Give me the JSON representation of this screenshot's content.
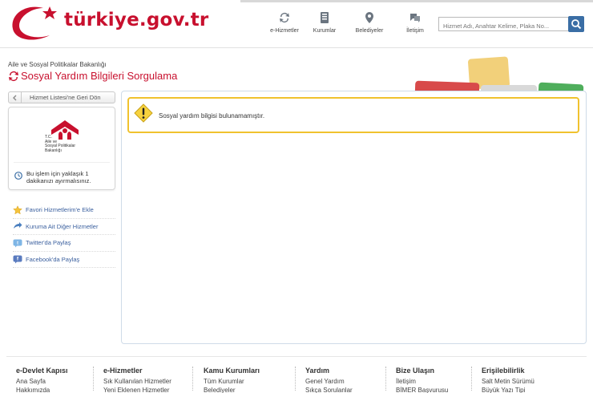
{
  "header": {
    "logo_text": "türkiye.gov.tr",
    "nav": [
      {
        "label": "e-Hizmetler",
        "icon": "refresh-arrows-icon"
      },
      {
        "label": "Kurumlar",
        "icon": "building-icon"
      },
      {
        "label": "Belediyeler",
        "icon": "map-pin-icon"
      },
      {
        "label": "İletişim",
        "icon": "chat-bubble-icon"
      }
    ],
    "search_placeholder": "Hizmet Adı, Anahtar Kelime, Plaka No...",
    "search_icon": "search-icon"
  },
  "page": {
    "breadcrumb": "Aile ve Sosyal Politikalar Bakanlığı",
    "title": "Sosyal Yardım Bilgileri Sorgulama"
  },
  "sidebar": {
    "back_label": "Hizmet Listesi'ne Geri Dön",
    "org_lines": [
      "T.C.",
      "Aile ve",
      "Sosyal Politikalar",
      "Bakanlığı"
    ],
    "time_text": "Bu işlem için yaklaşık 1 dakikanızı ayırmalısınız.",
    "links": [
      {
        "label": "Favori Hizmetlerim'e Ekle",
        "icon": "star-icon"
      },
      {
        "label": "Kuruma Ait Diğer Hizmetler",
        "icon": "arrow-icon"
      },
      {
        "label": "Twitter'da Paylaş",
        "icon": "twitter-icon"
      },
      {
        "label": "Facebook'da Paylaş",
        "icon": "facebook-icon"
      }
    ]
  },
  "main": {
    "alert_text": "Sosyal yardım bilgisi bulunamamıştır.",
    "alert_icon": "warning-icon"
  },
  "footer": {
    "columns": [
      {
        "heading": "e-Devlet Kapısı",
        "links": [
          "Ana Sayfa",
          "Hakkımızda"
        ]
      },
      {
        "heading": "e-Hizmetler",
        "links": [
          "Sık Kullanılan Hizmetler",
          "Yeni Eklenen Hizmetler"
        ]
      },
      {
        "heading": "Kamu Kurumları",
        "links": [
          "Tüm Kurumlar",
          "Belediyeler"
        ]
      },
      {
        "heading": "Yardım",
        "links": [
          "Genel Yardım",
          "Sıkça Sorulanlar"
        ]
      },
      {
        "heading": "Bize Ulaşın",
        "links": [
          "İletişim",
          "BİMER Başvurusu"
        ]
      },
      {
        "heading": "Erişilebilirlik",
        "links": [
          "Salt Metin Sürümü",
          "Büyük Yazı Tipi"
        ]
      }
    ]
  },
  "colors": {
    "brand_red": "#c8102e",
    "link_blue": "#3a5f9e",
    "alert_yellow": "#f0c22e"
  }
}
